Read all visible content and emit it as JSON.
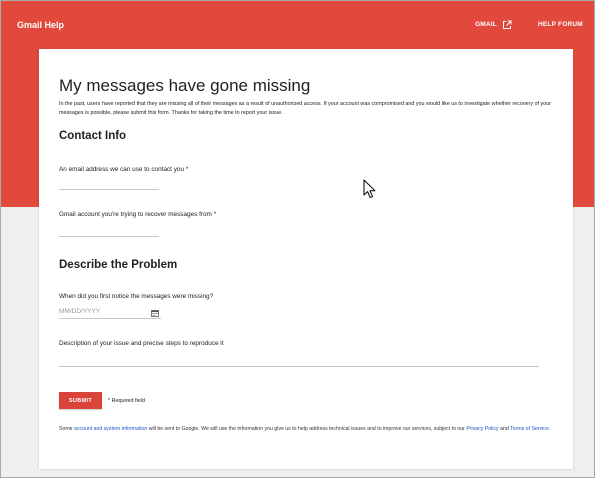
{
  "header": {
    "brand": "Gmail Help",
    "gmail_link": "GMAIL",
    "help_forum_link": "HELP FORUM",
    "external_icon": "external-link-icon"
  },
  "form": {
    "title": "My messages have gone missing",
    "intro": "In the past, users have reported that they are missing all of their messages as a result of unauthorized access. If your account was compromised and you would like us to investigate whether recovery of your messages is possible, please submit this form. Thanks for taking the time to report your issue.",
    "contact_section": "Contact Info",
    "email_label": "An email address we can use to contact you *",
    "email_value": "",
    "account_label": "Gmail account you're trying to recover messages from *",
    "account_value": "",
    "problem_section": "Describe the Problem",
    "date_label": "When did you first notice the messages were missing?",
    "date_placeholder": "MM/DD/YYYY",
    "calendar_icon": "calendar-icon",
    "description_label": "Description of your issue and precise steps to reproduce it",
    "description_value": "",
    "submit_label": "SUBMIT",
    "required_note": "* Required field"
  },
  "footer": {
    "text_1": "Some ",
    "link_account_info": "account and system information",
    "text_2": " will be sent to Google. We will use the information you give us to help address technical issues and to improve our services, subject to our ",
    "link_privacy": "Privacy Policy",
    "text_3": " and ",
    "link_terms": "Terms of Service",
    "text_4": "."
  },
  "colors": {
    "brand_red": "#e0493c",
    "submit_red": "#d9453a",
    "link_blue": "#1a56c8"
  }
}
